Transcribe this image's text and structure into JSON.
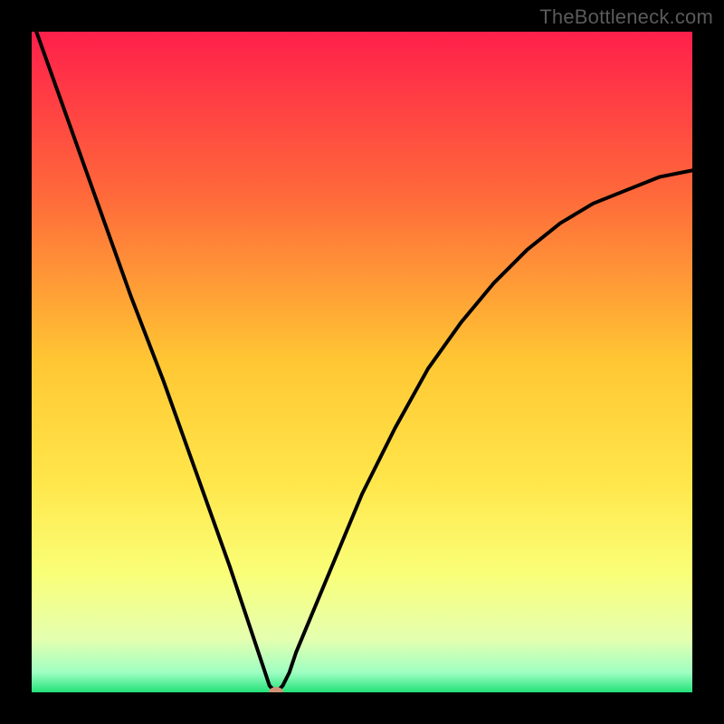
{
  "watermark": "TheBottleneck.com",
  "chart_data": {
    "type": "line",
    "title": "",
    "xlabel": "",
    "ylabel": "",
    "xlim": [
      0,
      100
    ],
    "ylim": [
      0,
      100
    ],
    "x": [
      0,
      5,
      10,
      15,
      20,
      25,
      30,
      33,
      35,
      36,
      37,
      38,
      39,
      40,
      45,
      50,
      55,
      60,
      65,
      70,
      75,
      80,
      85,
      90,
      95,
      100
    ],
    "values": [
      102,
      88,
      74,
      60,
      47,
      33,
      19,
      10,
      4,
      1,
      0,
      1,
      3,
      6,
      18,
      30,
      40,
      49,
      56,
      62,
      67,
      71,
      74,
      76,
      78,
      79
    ],
    "marker": {
      "x": 37,
      "y": 0
    },
    "gradient_stops": [
      {
        "offset": 0.0,
        "color": "#ff1f4b"
      },
      {
        "offset": 0.25,
        "color": "#ff6a3a"
      },
      {
        "offset": 0.5,
        "color": "#ffc733"
      },
      {
        "offset": 0.68,
        "color": "#ffe64a"
      },
      {
        "offset": 0.82,
        "color": "#faff78"
      },
      {
        "offset": 0.92,
        "color": "#e4ffb0"
      },
      {
        "offset": 0.97,
        "color": "#9fffc2"
      },
      {
        "offset": 1.0,
        "color": "#23e27a"
      }
    ]
  }
}
